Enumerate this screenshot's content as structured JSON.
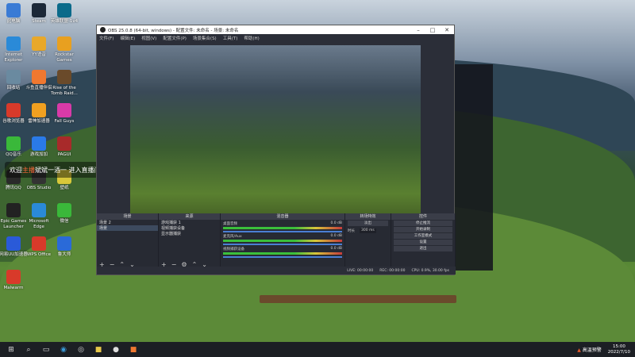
{
  "desktop": {
    "icons": [
      {
        "label": "此电脑",
        "icon": "computer-icon",
        "color": "#3a7bd5"
      },
      {
        "label": "Steam",
        "icon": "steam-icon",
        "color": "#1b2838"
      },
      {
        "label": "英雄联盟-1v4",
        "icon": "lol-icon",
        "color": "#0a6a8a"
      },
      {
        "label": "Internet Explorer",
        "icon": "ie-icon",
        "color": "#2a8ad8"
      },
      {
        "label": "YY语音",
        "icon": "yy-icon",
        "color": "#e8a82a"
      },
      {
        "label": "Rockstar Games",
        "icon": "rockstar-icon",
        "color": "#e8a020"
      },
      {
        "label": "回收站",
        "icon": "recycle-bin-icon",
        "color": "#6a8aa0"
      },
      {
        "label": "斗鱼直播伴侣",
        "icon": "douyu-icon",
        "color": "#f07830"
      },
      {
        "label": "Rise of the Tomb Raid...",
        "icon": "tombraider-icon",
        "color": "#6a4a2a"
      },
      {
        "label": "谷歌浏览器",
        "icon": "chrome-icon",
        "color": "#d83a2a"
      },
      {
        "label": "雷神加速器",
        "icon": "leishen-icon",
        "color": "#f0a020"
      },
      {
        "label": "Fall Guys",
        "icon": "fallguys-icon",
        "color": "#d83aa8"
      },
      {
        "label": "QQ音乐",
        "icon": "qqmusic-icon",
        "color": "#3ab83a"
      },
      {
        "label": "游戏加加",
        "icon": "youxijiajia-icon",
        "color": "#2a7ae8"
      },
      {
        "label": "PAGUI",
        "icon": "pagui-icon",
        "color": "#a82a2a"
      },
      {
        "label": "腾讯QQ",
        "icon": "qq-icon",
        "color": "#2a2a2a"
      },
      {
        "label": "OBS Studio",
        "icon": "obs-icon",
        "color": "#333"
      },
      {
        "label": "壁纸",
        "icon": "wallpaper-icon",
        "color": "#d8c83a"
      },
      {
        "label": "Epic Games Launcher",
        "icon": "epic-icon",
        "color": "#222"
      },
      {
        "label": "Microsoft Edge",
        "icon": "edge-icon",
        "color": "#2a8ad8"
      },
      {
        "label": "微信",
        "icon": "wechat-icon",
        "color": "#3ab83a"
      },
      {
        "label": "网易UU加速器",
        "icon": "uu-icon",
        "color": "#2a5ad8"
      },
      {
        "label": "WPS Office",
        "icon": "wps-icon",
        "color": "#d83a2a"
      },
      {
        "label": "鲁大师",
        "icon": "ludashi-icon",
        "color": "#2a6ad8"
      },
      {
        "label": "Malwarm",
        "icon": "malwarm-icon",
        "color": "#d83a2a"
      }
    ]
  },
  "notice": {
    "pre": "欢迎",
    "name": "主播",
    "post": "斌斌一酒一 进入直播间"
  },
  "obs": {
    "title": "OBS 25.0.8 (64-bit, windows) - 配置文件: 未命名 - 场景: 未命名",
    "menu": [
      "文件(F)",
      "编辑(E)",
      "视图(V)",
      "配置文件(P)",
      "场景集合(S)",
      "工具(T)",
      "帮助(H)"
    ],
    "panels": {
      "scenes": {
        "title": "场景",
        "items": [
          "场景 2",
          "场景"
        ]
      },
      "sources": {
        "title": "来源",
        "items": [
          "游戏捕获 1",
          "视频捕获设备",
          "显示器捕获"
        ]
      },
      "mixer": {
        "title": "混音器",
        "channels": [
          {
            "name": "桌面音频",
            "db": "0.0 dB"
          },
          {
            "name": "麦克风/Aux",
            "db": "0.0 dB"
          },
          {
            "name": "视频捕获设备",
            "db": "0.0 dB"
          }
        ]
      },
      "transitions": {
        "title": "转场特效",
        "mode": "淡出",
        "duration_label": "时长",
        "duration": "300 ms"
      },
      "controls": {
        "title": "控件",
        "buttons": [
          "停止推流",
          "开始录制",
          "工作室模式",
          "设置",
          "退出"
        ]
      }
    },
    "status": {
      "live": "LIVE: 00:00:00",
      "rec": "REC: 00:00:00",
      "cpu": "CPU: 0.9%, 30.00 fps"
    }
  },
  "taskbar": {
    "time": "15:00",
    "date": "2022/7/10",
    "status": "高温预警"
  }
}
